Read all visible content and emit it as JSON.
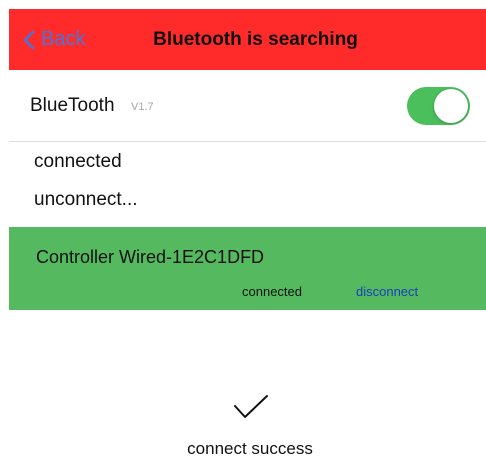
{
  "nav": {
    "back_label": "Back",
    "title": "Bluetooth is searching",
    "bar_color": "#ff2a2a",
    "back_color": "#4a74d9"
  },
  "bluetooth": {
    "label": "BlueTooth",
    "version": "V1.7",
    "enabled": true,
    "toggle_color": "#4bbf5c"
  },
  "status_lines": [
    "connected",
    "unconnect..."
  ],
  "device": {
    "name": "Controller Wired-1E2C1DFD",
    "state": "connected",
    "action_label": "disconnect",
    "row_color": "#55b95f"
  },
  "result": {
    "icon": "checkmark-icon",
    "message": "connect success"
  }
}
